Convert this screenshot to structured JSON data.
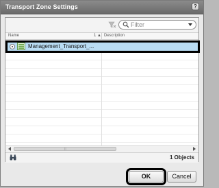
{
  "dialog": {
    "title": "Transport Zone Settings",
    "help_label": "?"
  },
  "toolbar": {
    "filter_placeholder": "Filter"
  },
  "table": {
    "columns": [
      "Name",
      "1 ▲",
      "Description"
    ],
    "rows": [
      {
        "name": "Management_Transport_...",
        "description": "",
        "selected": true
      }
    ]
  },
  "footer": {
    "count": "1 Objects"
  },
  "buttons": {
    "ok": "OK",
    "cancel": "Cancel"
  },
  "colors": {
    "selection": "#b9dcf3",
    "titlebar": "#7a7a7a"
  },
  "icons": {
    "clear_filter": "clear-filter-icon",
    "search": "search-icon",
    "transport_zone": "transport-zone-icon",
    "find": "binoculars-icon"
  }
}
